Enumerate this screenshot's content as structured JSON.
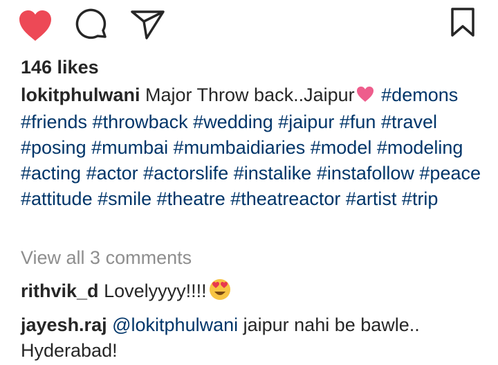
{
  "actions": {
    "like_icon": "heart-filled",
    "like_color": "#ed4956",
    "comment_icon": "speech-bubble",
    "share_icon": "paper-plane",
    "save_icon": "bookmark"
  },
  "likes": "146 likes",
  "caption": {
    "username": "lokitphulwani",
    "text": "Major Throw back..Jaipur",
    "emoji": "pink-heart",
    "hashtags": [
      "#demons",
      "#friends",
      "#throwback",
      "#wedding",
      "#jaipur",
      "#fun",
      "#travel",
      "#posing",
      "#mumbai",
      "#mumbaidiaries",
      "#model",
      "#modeling",
      "#acting",
      "#actor",
      "#actorslife",
      "#instalike",
      "#instafollow",
      "#peace",
      "#attitude",
      "#smile",
      "#theatre",
      "#theatreactor",
      "#artist",
      "#trip"
    ]
  },
  "view_all_comments": "View all 3 comments",
  "comments": [
    {
      "username": "rithvik_d",
      "text": "Lovelyyyy!!!!",
      "emoji": "heart-eyes"
    },
    {
      "username": "jayesh.raj",
      "mention": "@lokitphulwani",
      "text": "jaipur nahi be bawle.. Hyderabad!"
    }
  ],
  "colors": {
    "hashtag": "#003569",
    "text": "#262626",
    "muted": "#8e8e8e"
  }
}
